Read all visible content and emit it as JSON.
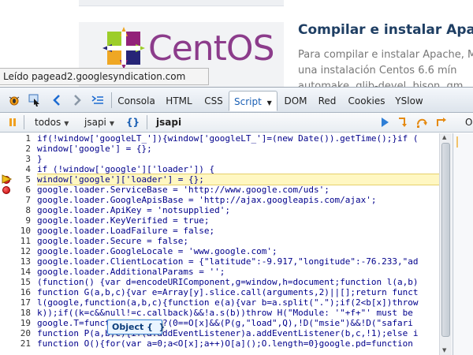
{
  "web_page": {
    "logo_text": "CentOS",
    "article_title": "Compilar e instalar Apache",
    "article_lines": [
      "Para compilar e instalar Apache, M",
      "una instalación Centos 6.6 mín",
      "automake, glib-devel, bison, gm"
    ]
  },
  "status_bar": {
    "text": "Leído pagead2.googlesyndication.com"
  },
  "firebug": {
    "tabs": [
      {
        "label": "Consola",
        "active": false
      },
      {
        "label": "HTML",
        "active": false
      },
      {
        "label": "CSS",
        "active": false
      },
      {
        "label": "Script",
        "active": true,
        "dropdown": true
      },
      {
        "label": "DOM",
        "active": false
      },
      {
        "label": "Red",
        "active": false
      },
      {
        "label": "Cookies",
        "active": false
      },
      {
        "label": "YSlow",
        "active": false
      }
    ],
    "toolbar_icons": [
      "firebug-icon",
      "inspect-icon",
      "back-icon",
      "forward-icon",
      "command-editor-icon"
    ],
    "script_bar": {
      "filter": "todos",
      "file": "jsapi",
      "pretty_print": "{}",
      "current_file": "jsapi",
      "right_label": "O"
    },
    "debug_icons": [
      "continue-icon",
      "step-into-icon",
      "step-over-icon",
      "step-out-icon"
    ],
    "source": {
      "current_line": 5,
      "breakpoints": [
        5,
        6
      ],
      "tooltip": "Object {  }",
      "lines": [
        {
          "n": "1",
          "text": "if(!window['googleLT_']){window['googleLT_']=(new Date()).getTime();}if ("
        },
        {
          "n": "2",
          "text": "window['google'] = {};"
        },
        {
          "n": "3",
          "text": "}"
        },
        {
          "n": "4",
          "text": "if (!window['google']['loader']) {"
        },
        {
          "n": "5",
          "text": "window['google']['loader'] = {};"
        },
        {
          "n": "6",
          "text": "google.loader.ServiceBase = 'http://www.google.com/uds';"
        },
        {
          "n": "7",
          "text": "google.loader.GoogleApisBase = 'http://ajax.googleapis.com/ajax';"
        },
        {
          "n": "8",
          "text": "google.loader.ApiKey = 'notsupplied';"
        },
        {
          "n": "9",
          "text": "google.loader.KeyVerified = true;"
        },
        {
          "n": "10",
          "text": "google.loader.LoadFailure = false;"
        },
        {
          "n": "11",
          "text": "google.loader.Secure = false;"
        },
        {
          "n": "12",
          "text": "google.loader.GoogleLocale = 'www.google.com';"
        },
        {
          "n": "13",
          "text": "google.loader.ClientLocation = {\"latitude\":-9.917,\"longitude\":-76.233,\"ad"
        },
        {
          "n": "14",
          "text": "google.loader.AdditionalParams = '';"
        },
        {
          "n": "15",
          "text": "(function() {var d=encodeURIComponent,g=window,h=document;function l(a,b)"
        },
        {
          "n": "16",
          "text": "function G(a,b,c){var e=Array[y].slice.call(arguments,2)||[];return funct"
        },
        {
          "n": "17",
          "text": "l(google,function(a,b,c){function e(a){var b=a.split(\".\");if(2<b[x])throw"
        },
        {
          "n": "18",
          "text": "k));if((k=c&&null!=c.callback)&&!a.s(b))throw H(\"Module: '\"+f+\"' must be"
        },
        {
          "n": "19",
          "text": "google.T=function(a,b){b?(0==O[x]&&(P(g,\"load\",Q),!D(\"msie\")&&!D(\"safari"
        },
        {
          "n": "20",
          "text": "function P(a,b,c){if(a.addEventListener)a.addEventListener(b,c,!1);else i"
        },
        {
          "n": "21",
          "text": "function O(){for(var a=0;a<O[x];a++)O[a]();O.length=0}google.pd=function"
        }
      ]
    }
  }
}
